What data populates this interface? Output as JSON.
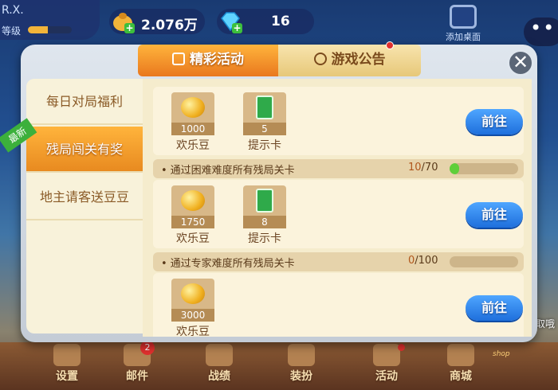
{
  "top_bar": {
    "user_name": "R.X.",
    "level_label": "等级",
    "level_progress": 0.45,
    "coins": "2.076万",
    "diamonds": "16",
    "add_to_desktop": "添加桌面"
  },
  "dialog": {
    "tabs": [
      {
        "label": "精彩活动",
        "active": true,
        "icon": "gift-icon"
      },
      {
        "label": "游戏公告",
        "active": false,
        "icon": "speaker-icon"
      }
    ],
    "sidebar": [
      {
        "label": "每日对局福利",
        "active": false
      },
      {
        "label": "残局闯关有奖",
        "active": true,
        "tag": "最新"
      },
      {
        "label": "地主请客送豆豆",
        "active": false
      }
    ],
    "rewards": [
      {
        "items": [
          {
            "qty": "1000",
            "name": "欢乐豆",
            "icon": "bean-icon"
          },
          {
            "qty": "5",
            "name": "提示卡",
            "icon": "hint-card-icon"
          }
        ],
        "button": "前往"
      },
      {
        "task": "通过困难难度所有残局关卡",
        "current": "10",
        "total": "/70",
        "progress": 0.143,
        "items": [
          {
            "qty": "1750",
            "name": "欢乐豆",
            "icon": "bean-icon"
          },
          {
            "qty": "8",
            "name": "提示卡",
            "icon": "hint-card-icon"
          }
        ],
        "button": "前往"
      },
      {
        "task": "通过专家难度所有残局关卡",
        "current": "0",
        "total": "/100",
        "progress": 0,
        "items": [
          {
            "qty": "3000",
            "name": "欢乐豆",
            "icon": "bean-icon"
          }
        ],
        "button": "前往"
      }
    ]
  },
  "bottom_nav": [
    {
      "label": "设置",
      "icon": "settings-icon"
    },
    {
      "label": "邮件",
      "icon": "mail-icon",
      "badge": "2"
    },
    {
      "label": "战绩",
      "icon": "trophy-icon"
    },
    {
      "label": "装扮",
      "icon": "outfit-icon"
    },
    {
      "label": "活动",
      "icon": "activity-gift-icon",
      "dot": true
    },
    {
      "label": "商城",
      "icon": "shop-cart-icon"
    }
  ],
  "shop_tag": "shop",
  "right_hint": "取哦"
}
